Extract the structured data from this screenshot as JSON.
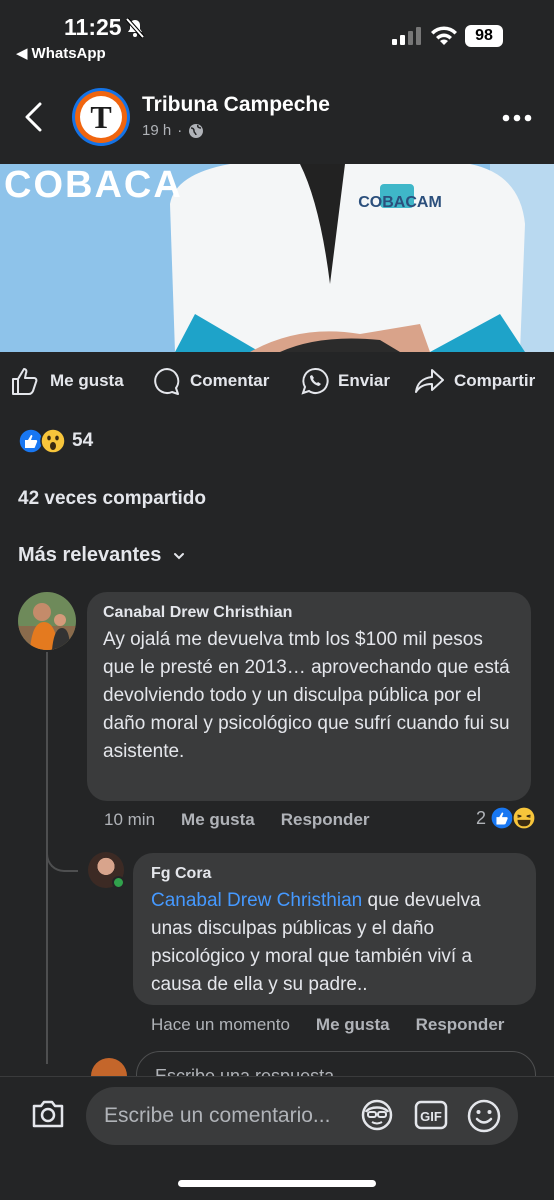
{
  "status_bar": {
    "time": "11:25",
    "back_app": "WhatsApp",
    "battery": "98"
  },
  "header": {
    "page_name": "Tribuna Campeche",
    "time_ago": "19 h",
    "avatar_letter": "T"
  },
  "photo": {
    "overlay_text": "COBACA",
    "badge_text": "COBACAM"
  },
  "actions": {
    "like": "Me gusta",
    "comment": "Comentar",
    "send": "Enviar",
    "share": "Compartir"
  },
  "reactions": {
    "count": "54"
  },
  "shares": "42 veces compartido",
  "sort_label": "Más relevantes",
  "comments": [
    {
      "author": "Canabal Drew Christhian",
      "text": "Ay ojalá me devuelva tmb los $100 mil pesos que le presté en 2013… aprovechando que está devolviendo todo y un disculpa pública por el daño moral y psicológico que sufrí cuando fui su asistente.",
      "time": "10 min",
      "like": "Me gusta",
      "reply": "Responder",
      "reaction_count": "2"
    }
  ],
  "reply": {
    "author": "Fg Cora",
    "mention": "Canabal Drew Christhian",
    "text": " que devuelva unas disculpas públicas y el daño psicológico y moral que también viví a causa de ella y su padre..",
    "time": "Hace un momento",
    "like": "Me gusta",
    "reply": "Responder"
  },
  "reply_box": {
    "placeholder": "Escribe una respuesta..."
  },
  "composer": {
    "placeholder": "Escribe un comentario..."
  }
}
